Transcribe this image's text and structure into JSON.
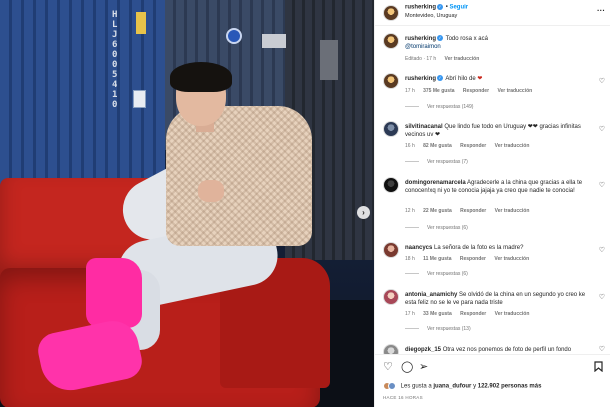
{
  "header": {
    "username": "rusherking",
    "separator": "•",
    "follow_label": "Seguir",
    "location": "Montevideo, Uruguay",
    "more_icon": "more-horizontal-icon"
  },
  "caption": {
    "username": "rusherking",
    "text": "Todo rosa x acá",
    "mention": "@tomiraimon",
    "edited": "Editado · 17 h",
    "see_translation": "Ver traducción"
  },
  "comments": [
    {
      "username": "rusherking",
      "text": "Abrí hilo de",
      "emoji": "❤",
      "time": "17 h",
      "likes": "375 Me gusta",
      "reply": "Responder",
      "translate": "Ver traducción",
      "replies": "Ver respuestas (149)"
    },
    {
      "username": "silvitinacanal",
      "text": "Que lindo fue todo en Uruguay ❤❤ gracias infinitas vecinos",
      "suffix": "uv ❤",
      "time": "16 h",
      "likes": "82 Me gusta",
      "reply": "Responder",
      "translate": "Ver traducción",
      "replies": "Ver respuestas (7)"
    },
    {
      "username": "domingorenamarcela",
      "text": "Agradecerle a la china que gracias a ella te conocen!xq ni yo te conocia jajaja ya creo que nadie te conocia!",
      "time": "12 h",
      "likes": "22 Me gusta",
      "reply": "Responder",
      "translate": "Ver traducción",
      "replies": "Ver respuestas (6)"
    },
    {
      "username": "naancycs",
      "text": "La señora de la foto es la madre?",
      "time": "18 h",
      "likes": "11 Me gusta",
      "reply": "Responder",
      "translate": "Ver traducción",
      "replies": "Ver respuestas (6)"
    },
    {
      "username": "antonia_anamichy",
      "text": "Se olvidó de la china en un segundo yo creo ke esta feliz no se le ve para nada triste",
      "time": "17 h",
      "likes": "33 Me gusta",
      "reply": "Responder",
      "translate": "Ver traducción",
      "replies": "Ver respuestas (13)"
    },
    {
      "username": "diegopzk_15",
      "text": "Otra vez nos ponemos de foto de perfil un fondo"
    }
  ],
  "actions": {
    "like_icon": "heart-icon",
    "comment_icon": "comment-icon",
    "share_icon": "send-icon",
    "save_icon": "bookmark-icon",
    "likes_prefix": "Les gusta a",
    "likes_user": "juana_dufour",
    "likes_connector": "y",
    "likes_count": "122.902 personas más",
    "posted_time": "HACE 16 HORAS"
  },
  "photo": {
    "next_icon": "chevron-right-icon",
    "container_text": "HLJ 6005 4 1 0",
    "next_glyph": "›"
  },
  "colors": {
    "link": "#0095f6",
    "verified": "#3897f0",
    "couch": "#c4261f",
    "boots": "#ff2ca3"
  }
}
